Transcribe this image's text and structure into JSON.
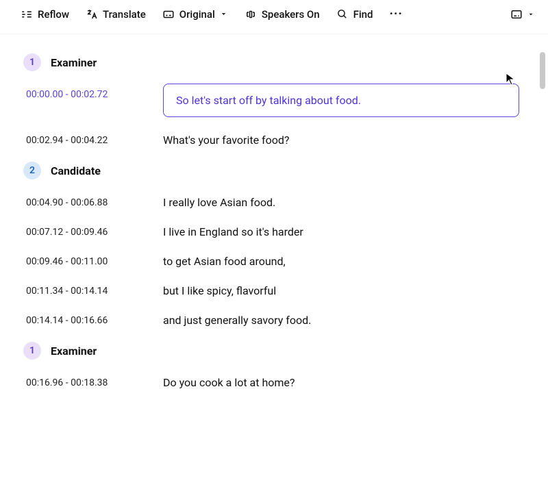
{
  "toolbar": {
    "reflow": "Reflow",
    "translate": "Translate",
    "original": "Original",
    "speakers": "Speakers On",
    "find": "Find"
  },
  "speakers": {
    "examiner": {
      "num": "1",
      "label": "Examiner"
    },
    "candidate": {
      "num": "2",
      "label": "Candidate"
    }
  },
  "lines": [
    {
      "ts": "00:00.00 - 00:02.72",
      "text": "So let's start off by talking about food."
    },
    {
      "ts": "00:02.94 - 00:04.22",
      "text": "What's your favorite food?"
    },
    {
      "ts": "00:04.90 - 00:06.88",
      "text": "I really love Asian food."
    },
    {
      "ts": "00:07.12  -  00:09.46",
      "text": "I live in England so it's harder"
    },
    {
      "ts": "00:09.46 - 00:11.00",
      "text": "to get Asian food around,"
    },
    {
      "ts": "00:11.34  -   00:14.14",
      "text": "but I like spicy, flavorful"
    },
    {
      "ts": "00:14.14  -  00:16.66",
      "text": "and just generally savory food."
    },
    {
      "ts": "00:16.96  -  00:18.38",
      "text": "Do you cook a lot at home?"
    }
  ]
}
